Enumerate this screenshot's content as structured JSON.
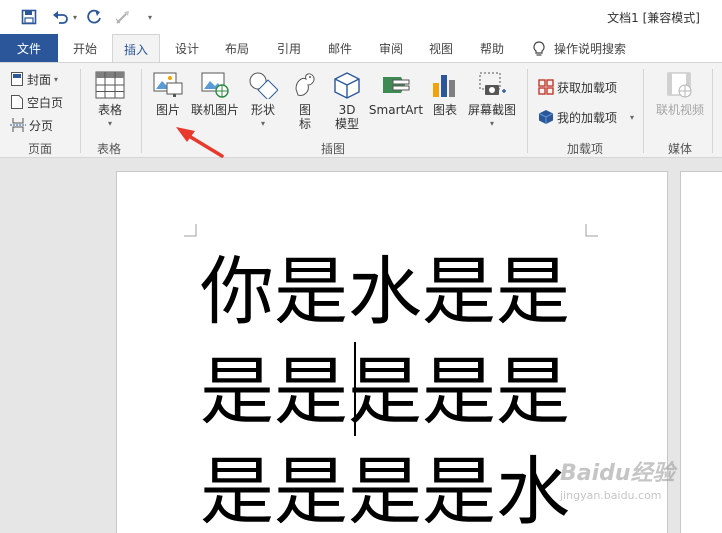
{
  "window": {
    "title": "文档1 [兼容模式]"
  },
  "quick_access": {
    "more": "▾"
  },
  "tabs": {
    "file": "文件",
    "items": [
      "开始",
      "插入",
      "设计",
      "布局",
      "引用",
      "邮件",
      "审阅",
      "视图",
      "帮助"
    ],
    "active": "插入",
    "search": "操作说明搜索"
  },
  "ribbon": {
    "pages": {
      "cover": "封面",
      "blank": "空白页",
      "break": "分页",
      "label": "页面"
    },
    "tables": {
      "table": "表格",
      "label": "表格"
    },
    "illustrations": {
      "picture": "图片",
      "online_picture": "联机图片",
      "shapes": "形状",
      "icons_1": "图",
      "icons_2": "标",
      "model_1": "3D",
      "model_2": "模型",
      "smartart": "SmartArt",
      "chart": "图表",
      "screenshot": "屏幕截图",
      "label": "插图"
    },
    "addins": {
      "get": "获取加载项",
      "mine": "我的加载项",
      "label": "加载项"
    },
    "media": {
      "online_video": "联机视频",
      "label": "媒体"
    }
  },
  "document": {
    "lines": [
      "你是水是是",
      "是是是是是",
      "是是是是水"
    ]
  },
  "watermark": {
    "brand": "Baidu经验",
    "url": "jingyan.baidu.com"
  },
  "colors": {
    "accent": "#2b579a",
    "arrow": "#e8392c"
  }
}
